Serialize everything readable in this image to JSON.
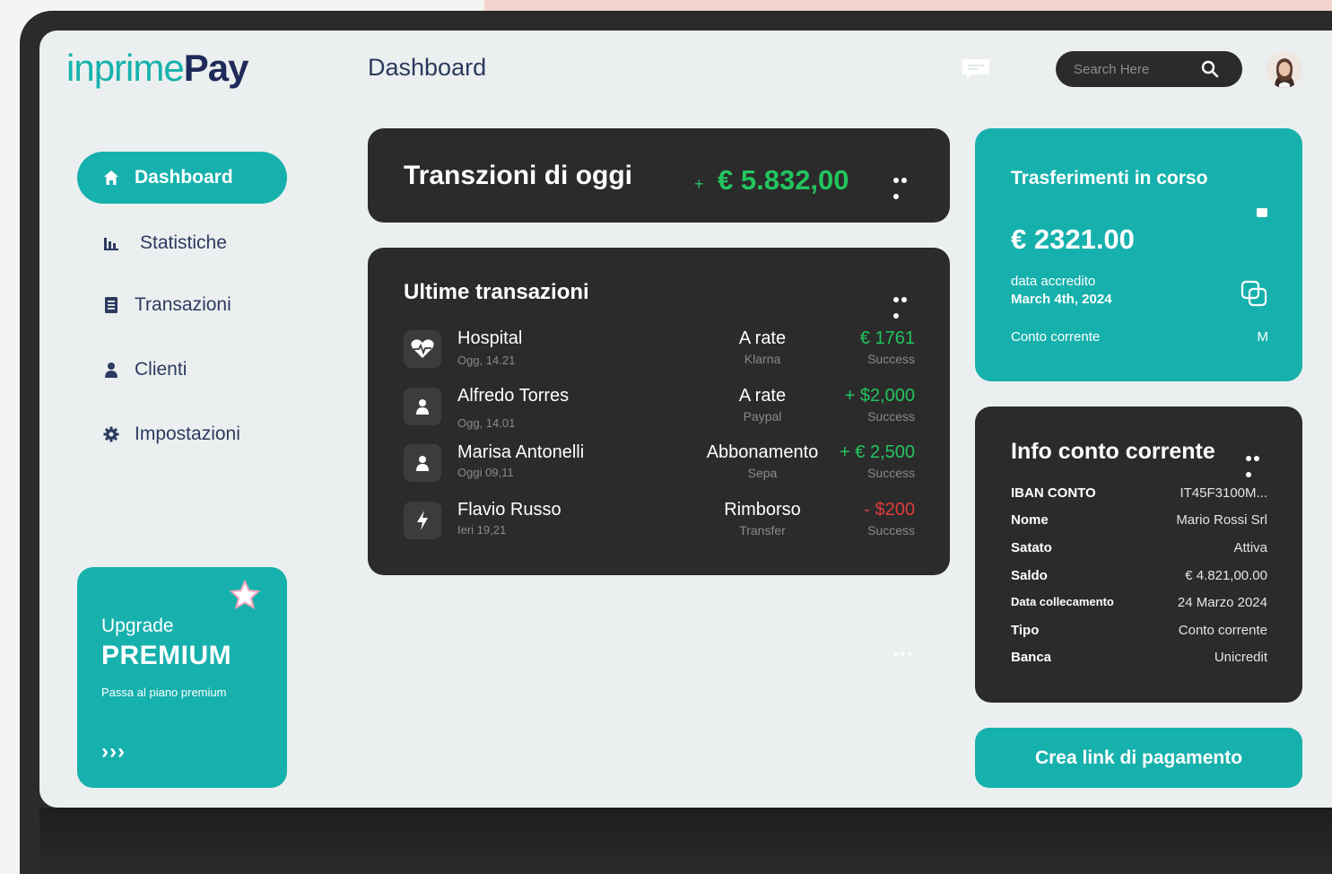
{
  "brand": {
    "part1": "inprime",
    "part2": "Pay"
  },
  "header": {
    "title": "Dashboard",
    "search_placeholder": "Search Here"
  },
  "sidebar": {
    "items": [
      {
        "label": "Dashboard",
        "icon": "home-icon",
        "active": true
      },
      {
        "label": "Statistiche",
        "icon": "bar-chart-icon"
      },
      {
        "label": "Transazioni",
        "icon": "document-icon"
      },
      {
        "label": "Clienti",
        "icon": "user-icon"
      },
      {
        "label": "Impostazioni",
        "icon": "gear-icon"
      }
    ],
    "upgrade": {
      "line1": "Upgrade",
      "line2": "PREMIUM",
      "line3": "Passa al piano premium",
      "arrows": "›››"
    }
  },
  "today_card": {
    "title": "Transzioni di oggi",
    "plus": "+",
    "amount": "€ 5.832,00"
  },
  "recent": {
    "title": "Ultime  transazioni",
    "rows": [
      {
        "name": "Hospital",
        "time": "Ogg, 14.21",
        "type": "A rate",
        "method": "Klarna",
        "amount": "€ 1761",
        "status": "Success",
        "icon": "heart-pulse-icon",
        "color": "#22c55e"
      },
      {
        "name": "Alfredo Torres",
        "time": "Ogg, 14.01",
        "type": "A rate",
        "method": "Paypal",
        "amount": "+ $2,000",
        "status": "Success",
        "icon": "user-icon",
        "color": "#22c55e"
      },
      {
        "name": "Marisa Antonelli",
        "time": "Oggi 09,11",
        "type": "Abbonamento",
        "method": "Sepa",
        "amount": "+ € 2,500",
        "status": "Success",
        "icon": "user-icon",
        "color": "#22c55e"
      },
      {
        "name": "Flavio Russo",
        "time": "Ieri 19,21",
        "type": "Rimborso",
        "method": "Transfer",
        "amount": "- $200",
        "status": "Success",
        "icon": "lightning-icon",
        "color": "#e23b3b"
      }
    ]
  },
  "transfers": {
    "title": "Trasferimenti in corso",
    "amount": "€ 2321.00",
    "date_label": "data accredito",
    "date_value": "March 4th, 2024",
    "account": "Conto corrente",
    "account_tag": "M"
  },
  "info": {
    "title": "Info conto corrente",
    "rows": [
      {
        "key": "IBAN CONTO",
        "value": "IT45F3100M..."
      },
      {
        "key": "Nome",
        "value": "Mario Rossi Srl"
      },
      {
        "key": "Satato",
        "value": "Attiva"
      },
      {
        "key": "Saldo",
        "value": "€ 4.821,00.00"
      },
      {
        "key": "Data collecamento",
        "value": "24 Marzo 2024"
      },
      {
        "key": "Tipo",
        "value": "Conto corrente"
      },
      {
        "key": "Banca",
        "value": "Unicredit"
      }
    ]
  },
  "cta": {
    "label": "Crea link di pagamento"
  },
  "colors": {
    "accent": "#17b1ad",
    "dark": "#2b2b2b",
    "positive": "#22c55e",
    "negative": "#e23b3b",
    "navy": "#1f2a5a"
  }
}
